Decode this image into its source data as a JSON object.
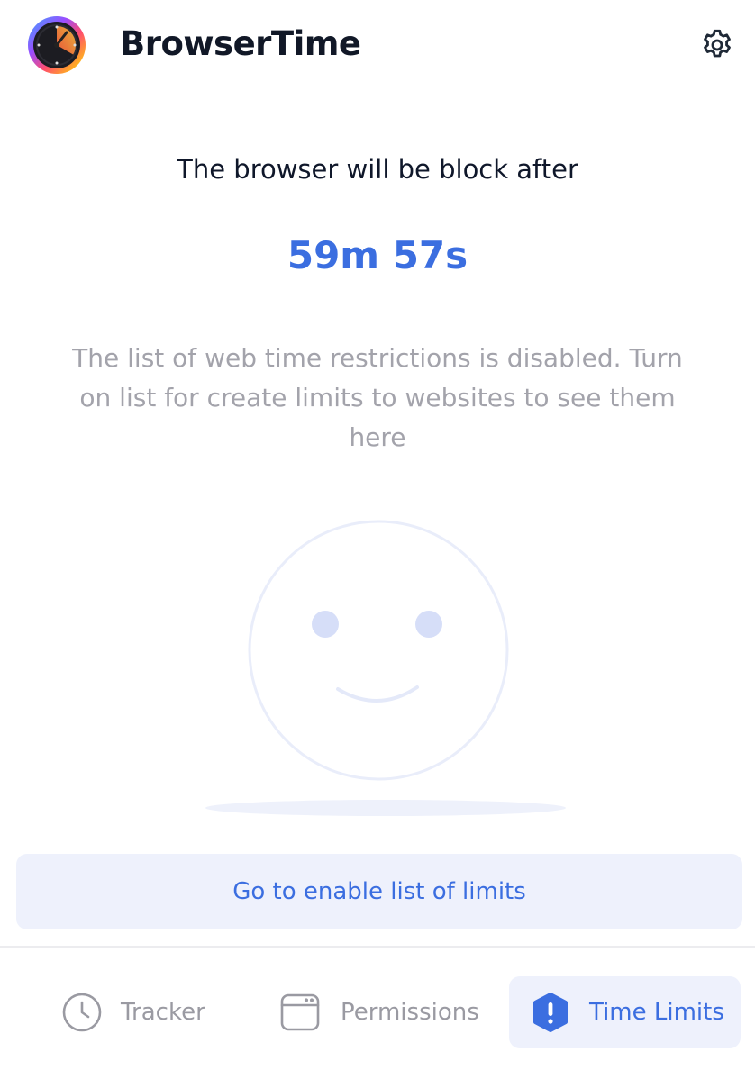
{
  "header": {
    "app_title": "BrowserTime",
    "logo_icon": "stopwatch-logo-icon",
    "settings_icon": "gear-icon"
  },
  "main": {
    "block_heading": "The browser will be block after",
    "countdown": "59m 57s",
    "empty_message": "The list of web time restrictions is disabled. Turn on list for create limits to websites to see them here",
    "illustration": "smiley-face-icon",
    "enable_button_label": "Go to enable list of limits"
  },
  "bottom_nav": {
    "tabs": [
      {
        "label": "Tracker",
        "icon": "clock-icon",
        "active": false
      },
      {
        "label": "Permissions",
        "icon": "browser-window-icon",
        "active": false
      },
      {
        "label": "Time Limits",
        "icon": "exclamation-shield-icon",
        "active": true
      }
    ]
  },
  "colors": {
    "accent": "#3b6ee0",
    "accent_bg": "#eef1fc",
    "title_text": "#111827",
    "muted_text": "#a3a3ab",
    "illustration_line": "#e9edfa",
    "illustration_eyes": "#d6def8"
  }
}
